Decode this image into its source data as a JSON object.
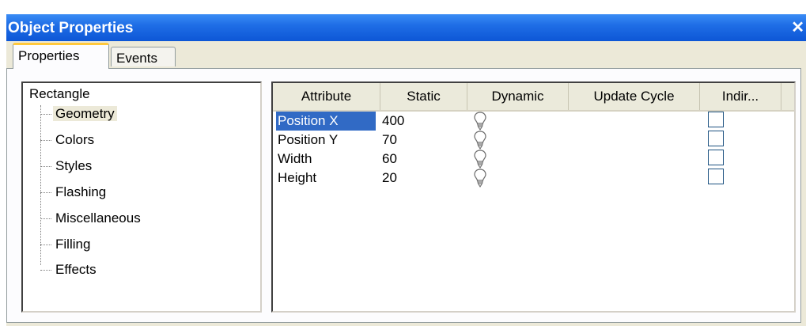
{
  "window": {
    "title": "Object Properties",
    "close_glyph": "✕"
  },
  "tabs": [
    {
      "label": "Properties",
      "active": true
    },
    {
      "label": "Events",
      "active": false
    }
  ],
  "tree": {
    "root": "Rectangle",
    "items": [
      {
        "label": "Geometry",
        "selected": true
      },
      {
        "label": "Colors"
      },
      {
        "label": "Styles"
      },
      {
        "label": "Flashing"
      },
      {
        "label": "Miscellaneous"
      },
      {
        "label": "Filling"
      },
      {
        "label": "Effects"
      }
    ]
  },
  "grid": {
    "columns": [
      "Attribute",
      "Static",
      "Dynamic",
      "Update Cycle",
      "Indir..."
    ],
    "rows": [
      {
        "attribute": "Position X",
        "static": "400",
        "dynamic_icon": "lightbulb-icon",
        "indirect": false,
        "selected": true
      },
      {
        "attribute": "Position Y",
        "static": "70",
        "dynamic_icon": "lightbulb-icon",
        "indirect": false
      },
      {
        "attribute": "Width",
        "static": "60",
        "dynamic_icon": "lightbulb-icon",
        "indirect": false
      },
      {
        "attribute": "Height",
        "static": "20",
        "dynamic_icon": "lightbulb-icon",
        "indirect": false
      }
    ]
  },
  "colors": {
    "titlebar": "#0d56d6",
    "selection": "#316ac5",
    "tab_highlight": "#ffc83c"
  }
}
